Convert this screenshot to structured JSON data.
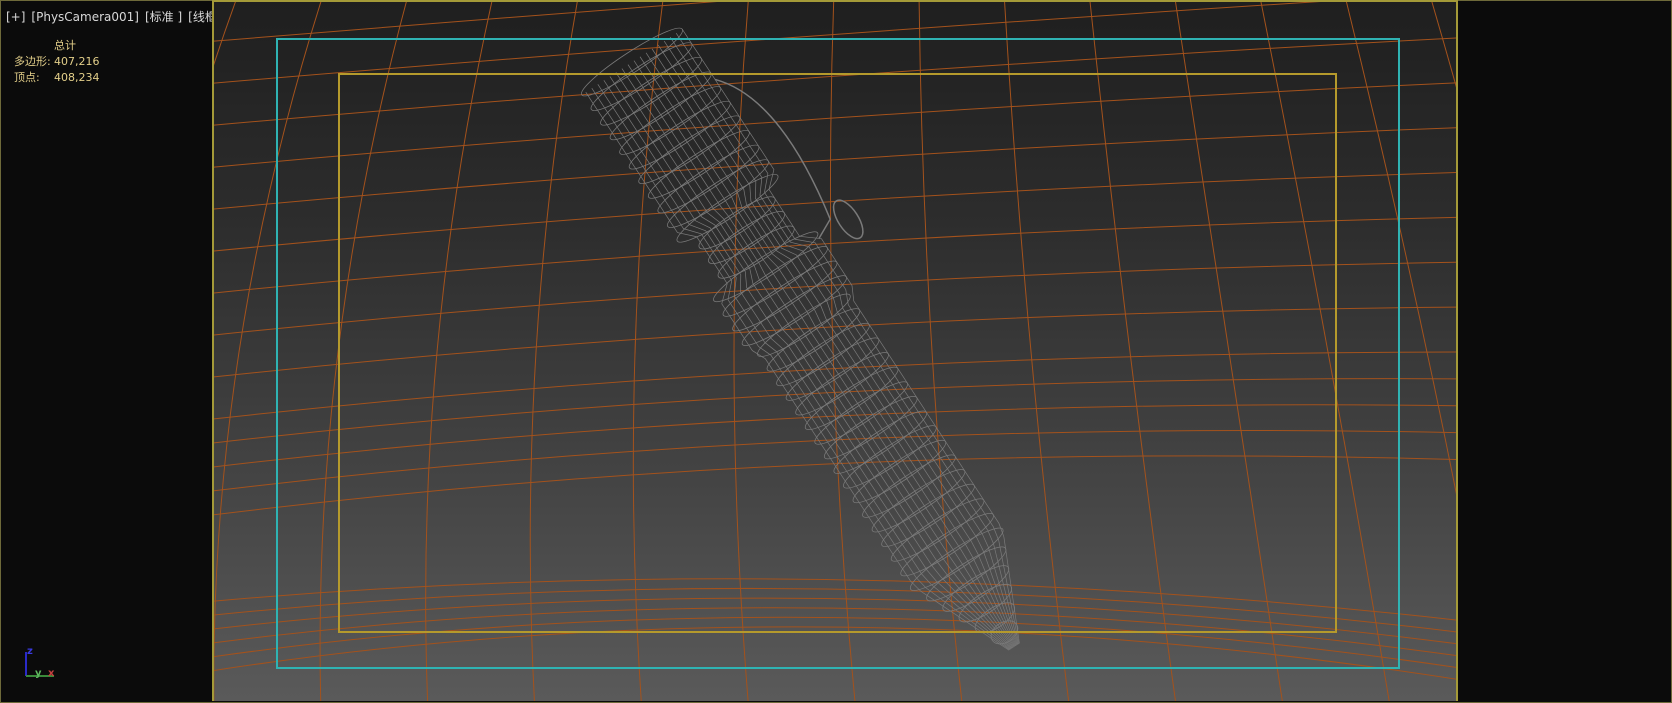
{
  "viewport_label": {
    "menu": "[+]",
    "camera": "[PhysCamera001]",
    "shading": "[标准 ]",
    "style": "[线框 ]"
  },
  "stats": {
    "header": "总计",
    "polygons_label": "多边形:",
    "polygons": "407,216",
    "vertices_label": "顶点:",
    "vertices": "408,234"
  },
  "gizmo": {
    "z": "z",
    "y": "y",
    "x": "x"
  },
  "colors": {
    "safe_frame_outer": "#2fb3b3",
    "safe_frame_inner": "#b59a2c",
    "grid": "#a4521c",
    "wireframe": "#7a7a7a",
    "viewport_border": "#a49a38"
  }
}
